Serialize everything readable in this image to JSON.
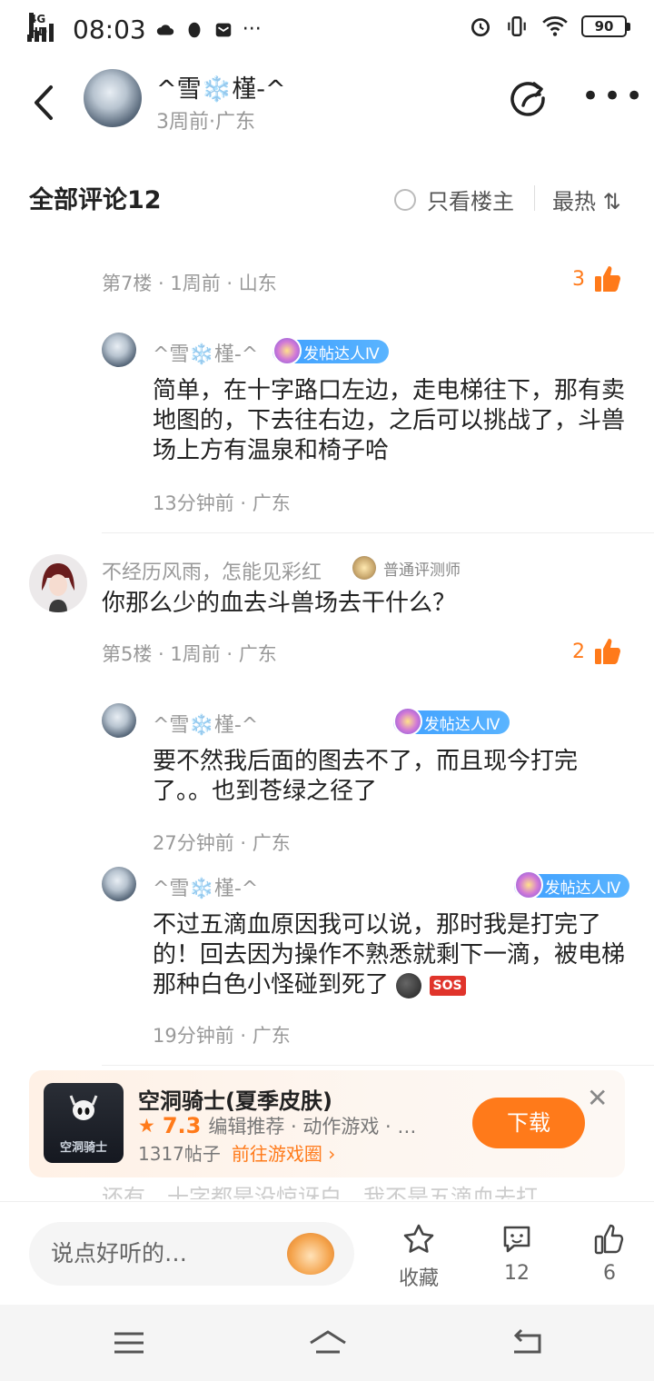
{
  "status": {
    "network": "4G HD",
    "time": "08:03",
    "battery": "90"
  },
  "post": {
    "author": "^雪❄️槿-^",
    "meta": "3周前·广东"
  },
  "comments_header": {
    "title": "全部评论12",
    "only_op": "只看楼主",
    "sort": "最热",
    "sort_icon": "⇅"
  },
  "floor7": {
    "meta": "第7楼 · 1周前 · 山东",
    "likes": "3",
    "replies": [
      {
        "name": "^雪❄️槿-^",
        "badge": "发帖达人Ⅳ",
        "text": "简单，在十字路口左边，走电梯往下，那有卖地图的，下去往右边，之后可以挑战了，斗兽场上方有温泉和椅子哈",
        "meta": "13分钟前 · 广东"
      }
    ]
  },
  "floor5": {
    "user": "不经历风雨，怎能见彩红",
    "user_badge": "普通评测师",
    "text": "你那么少的血去斗兽场去干什么？",
    "meta": "第5楼 · 1周前 · 广东",
    "likes": "2",
    "replies": [
      {
        "name": "^雪❄️槿-^",
        "badge": "发帖达人Ⅳ",
        "text": "要不然我后面的图去不了，而且现今打完了。。也到苍绿之径了",
        "meta": "27分钟前 · 广东"
      },
      {
        "name": "^雪❄️槿-^",
        "badge": "发帖达人Ⅳ",
        "text": "不过五滴血原因我可以说，那时我是打完了的！回去因为操作不熟悉就剩下一滴，被电梯那种白色小怪碰到死了",
        "sos": "SOS",
        "meta": "19分钟前 · 广东"
      }
    ]
  },
  "faded": "还有，十字都是没惊讶白，我不是五滴血去打",
  "ad": {
    "thumb_label": "空洞骑士",
    "title": "空洞骑士(夏季皮肤)",
    "score": "7.3",
    "tags": "编辑推荐 · 动作游戏 · …",
    "posts": "1317帖子",
    "link": "前往游戏圈",
    "button": "下载"
  },
  "bottom": {
    "placeholder": "说点好听的…",
    "favorite": "收藏",
    "comments": "12",
    "likes": "6"
  },
  "icons": [
    "back-icon",
    "share-icon",
    "more-icon",
    "thumb-up-icon",
    "star-icon",
    "comment-icon",
    "close-icon",
    "menu-icon",
    "home-icon",
    "return-icon"
  ],
  "colors": {
    "accent": "#ff7a1a",
    "badge": "#3fa0ff"
  }
}
